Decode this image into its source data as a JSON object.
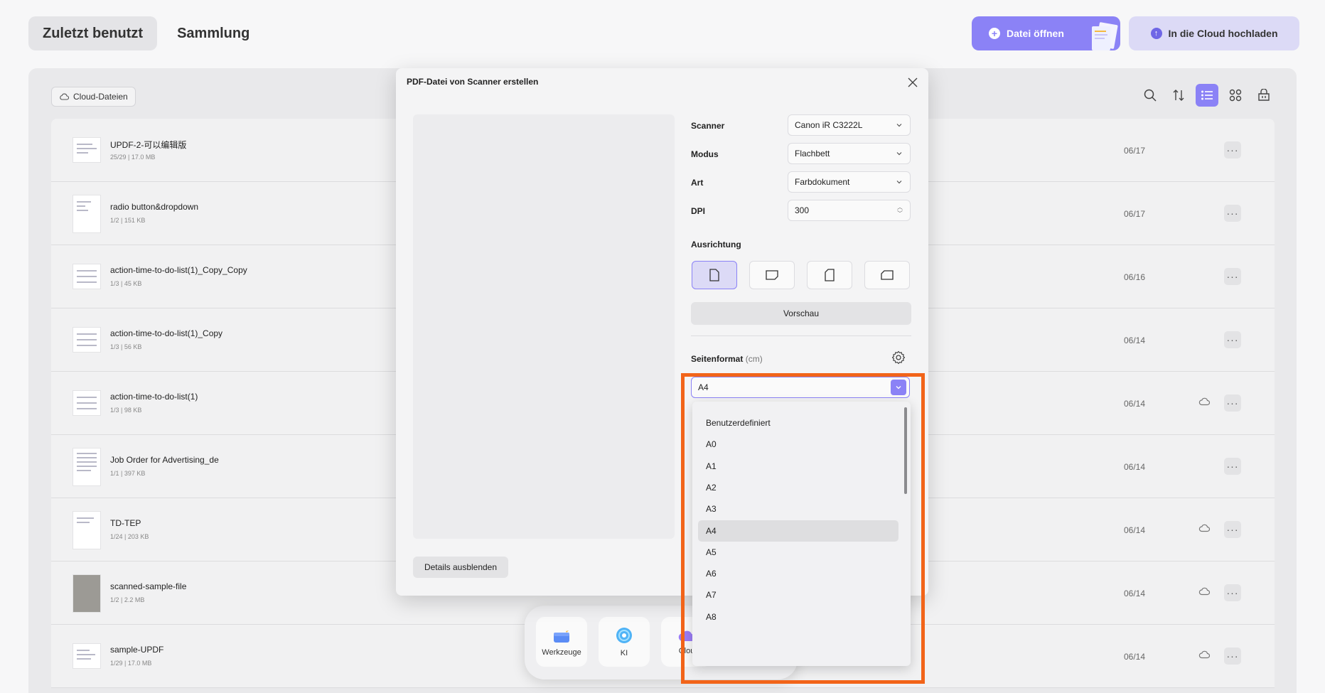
{
  "header": {
    "tabs": [
      {
        "label": "Zuletzt benutzt",
        "active": true
      },
      {
        "label": "Sammlung",
        "active": false
      }
    ],
    "open_file": "Datei öffnen",
    "upload_cloud": "In die Cloud hochladen"
  },
  "panel": {
    "cloud_files": "Cloud-Dateien",
    "toolbar_icons": [
      "search-icon",
      "sort-icon",
      "list-view-icon",
      "grid-view-icon",
      "basket-icon"
    ]
  },
  "files": [
    {
      "name": "UPDF-2-可以编辑版",
      "meta": "25/29 | 17.0 MB",
      "date": "06/17",
      "cloud": false
    },
    {
      "name": "radio button&dropdown",
      "meta": "1/2 | 151 KB",
      "date": "06/17",
      "cloud": false
    },
    {
      "name": "action-time-to-do-list(1)_Copy_Copy",
      "meta": "1/3 | 45 KB",
      "date": "06/16",
      "cloud": false
    },
    {
      "name": "action-time-to-do-list(1)_Copy",
      "meta": "1/3 | 56 KB",
      "date": "06/14",
      "cloud": false
    },
    {
      "name": "action-time-to-do-list(1)",
      "meta": "1/3 | 98 KB",
      "date": "06/14",
      "cloud": true
    },
    {
      "name": "Job Order for Advertising_de",
      "meta": "1/1 | 397 KB",
      "date": "06/14",
      "cloud": false
    },
    {
      "name": "TD-TEP",
      "meta": "1/24 | 203 KB",
      "date": "06/14",
      "cloud": true
    },
    {
      "name": "scanned-sample-file",
      "meta": "1/2 | 2.2 MB",
      "date": "06/14",
      "cloud": true
    },
    {
      "name": "sample-UPDF",
      "meta": "1/29 | 17.0 MB",
      "date": "06/14",
      "cloud": true
    }
  ],
  "dock": {
    "tools": "Werkzeuge",
    "ai": "KI",
    "cloud_partial": "Clou"
  },
  "modal": {
    "title": "PDF-Datei von Scanner erstellen",
    "scanner_label": "Scanner",
    "scanner_value": "Canon iR C3222L",
    "mode_label": "Modus",
    "mode_value": "Flachbett",
    "type_label": "Art",
    "type_value": "Farbdokument",
    "dpi_label": "DPI",
    "dpi_value": "300",
    "orientation_label": "Ausrichtung",
    "preview_button": "Vorschau",
    "page_format_label": "Seitenformat",
    "page_format_unit": "(cm)",
    "page_format_value": "A4",
    "details_button": "Details ausblenden",
    "format_options": [
      "Benutzerdefiniert",
      "A0",
      "A1",
      "A2",
      "A3",
      "A4",
      "A5",
      "A6",
      "A7",
      "A8"
    ],
    "selected_option": "A4"
  },
  "colors": {
    "accent": "#8b82f6",
    "highlight": "#f26419"
  }
}
